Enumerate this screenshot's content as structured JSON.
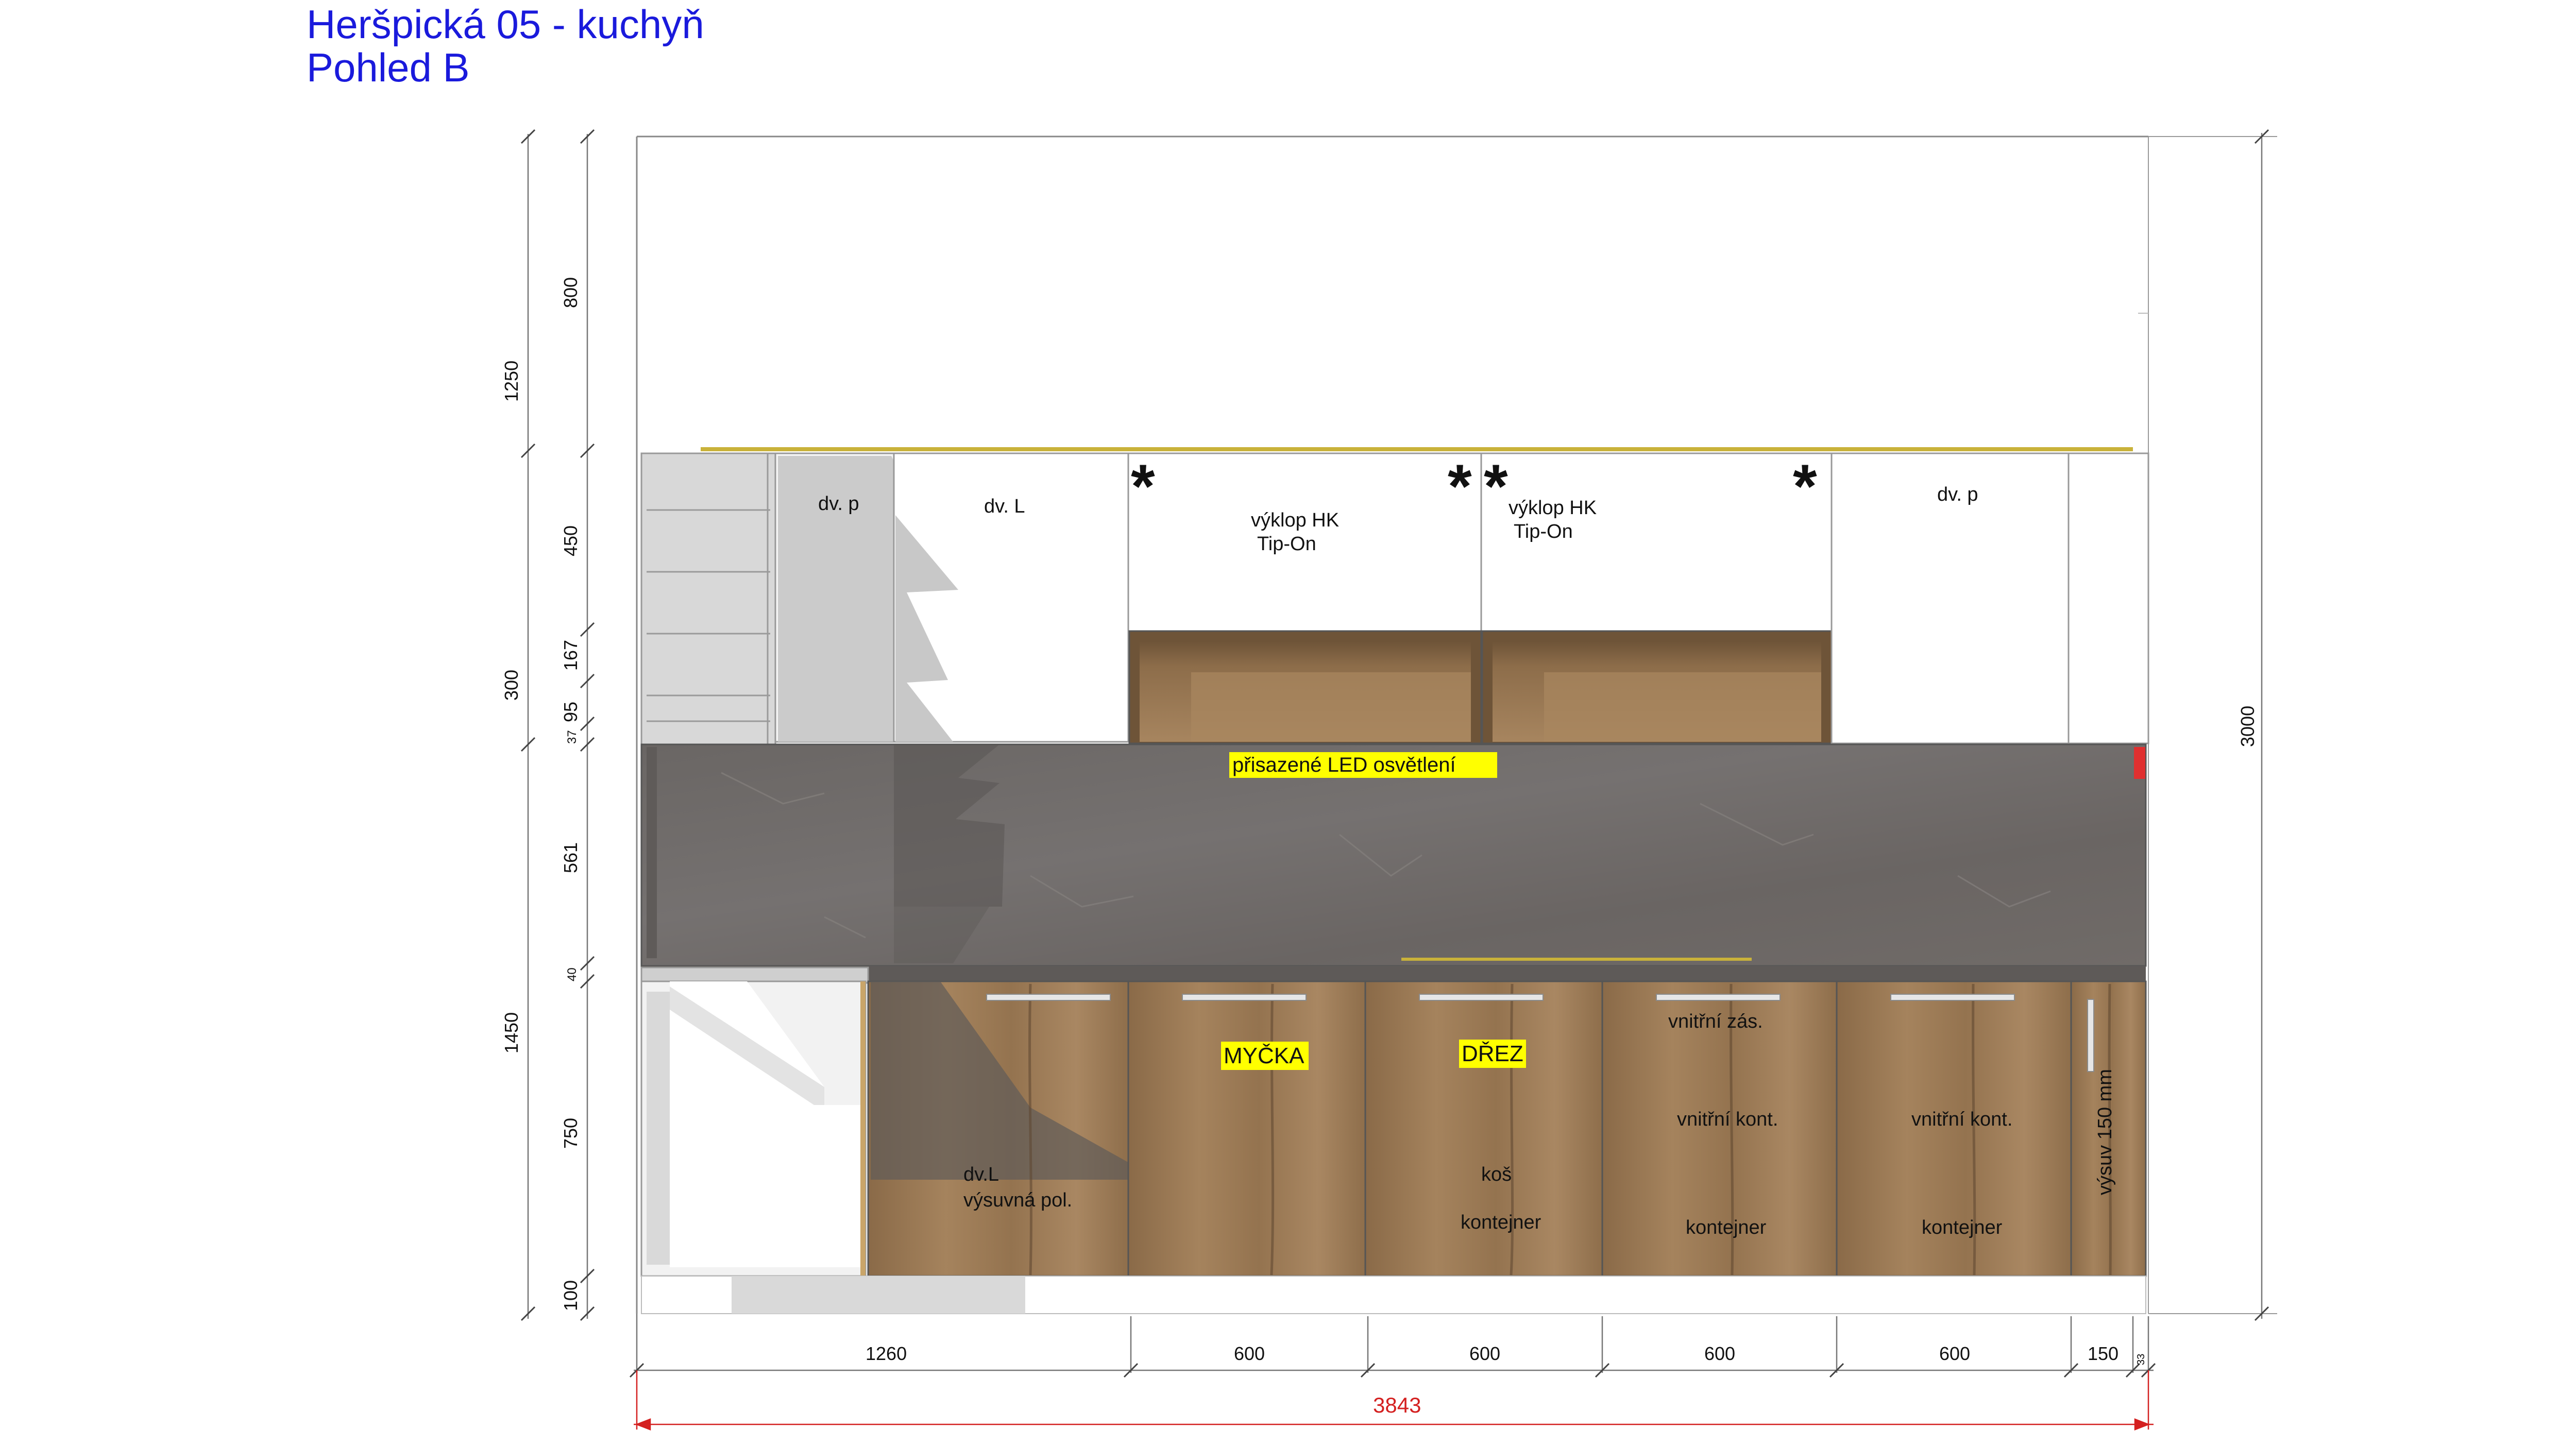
{
  "title": {
    "line1": "Heršpická 05 - kuchyň",
    "line2": "Pohled B"
  },
  "upper_labels": {
    "dv_p_left": "dv. p",
    "dv_L": "dv. L",
    "vyklop1_line1": "výklop HK",
    "vyklop1_line2": "Tip-On",
    "vyklop2_line1": "výklop HK",
    "vyklop2_line2": "Tip-On",
    "dv_p_right": "dv. p",
    "asterisk": "*"
  },
  "led_label": "přisazené LED osvětlení",
  "lower_labels": {
    "dvL": "dv.L",
    "vysuvna": "výsuvná pol.",
    "mycka": "MYČKA",
    "drez": "DŘEZ",
    "kos": "koš",
    "kontejner_sink": "kontejner",
    "vnitrni_zas": "vnitřní zás.",
    "vnitrni_kont1": "vnitřní kont.",
    "kontejner1": "kontejner",
    "vnitrni_kont2": "vnitřní kont.",
    "kontejner2": "kontejner",
    "vysuv": "výsuv 150 mm"
  },
  "dims_left_outer": {
    "d1250": "1250",
    "d300": "300",
    "d1450": "1450"
  },
  "dims_left_inner": {
    "d800": "800",
    "d450": "450",
    "d167": "167",
    "d95": "95",
    "d37": "37",
    "d561": "561",
    "d40": "40",
    "d750": "750",
    "d100": "100"
  },
  "dim_right": "3000",
  "dims_bottom": {
    "d1260": "1260",
    "d600a": "600",
    "d600b": "600",
    "d600c": "600",
    "d600d": "600",
    "d150": "150",
    "d33": "33"
  },
  "dim_total": "3843",
  "colors": {
    "title": "#1a1adc",
    "highlight": "#ffff00",
    "total_dim": "#d42020",
    "countertop": "#6b6765",
    "wood": "#9c7b57",
    "led_strip": "#c9b23a"
  }
}
